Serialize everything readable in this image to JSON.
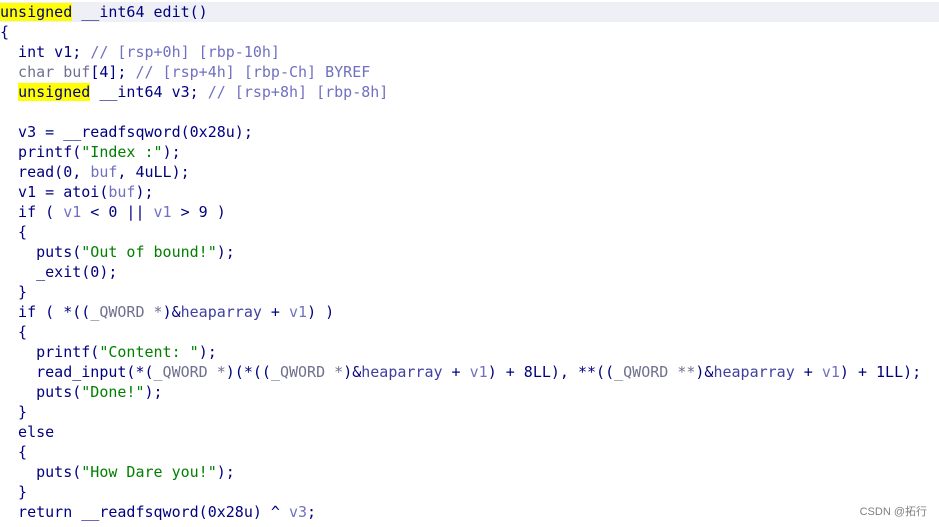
{
  "lines": [
    [
      [
        "unsigned",
        "kw",
        "hl"
      ],
      [
        " __int64 edit()",
        "kw"
      ]
    ],
    [
      [
        "{",
        "punc"
      ]
    ],
    [
      [
        "  int v1; ",
        "kw"
      ],
      [
        "// [rsp+0h] [rbp-10h]",
        "comment"
      ]
    ],
    [
      [
        "  char buf",
        "type"
      ],
      [
        "[4]",
        "kw"
      ],
      [
        "; ",
        "kw"
      ],
      [
        "// [rsp+4h] [rbp-Ch] BYREF",
        "comment"
      ]
    ],
    [
      [
        "  ",
        "kw"
      ],
      [
        "unsigned",
        "kw",
        "hl"
      ],
      [
        " __int64 v3; ",
        "kw"
      ],
      [
        "// [rsp+8h] [rbp-8h]",
        "comment"
      ]
    ],
    [
      [
        "",
        "kw"
      ]
    ],
    [
      [
        "  v3 = __readfsqword(0x28u);",
        "kw"
      ]
    ],
    [
      [
        "  printf(",
        "kw"
      ],
      [
        "\"Index :\"",
        "str"
      ],
      [
        ");",
        "kw"
      ]
    ],
    [
      [
        "  read(0, ",
        "kw"
      ],
      [
        "buf",
        "var"
      ],
      [
        ", 4uLL);",
        "kw"
      ]
    ],
    [
      [
        "  v1 = atoi(",
        "kw"
      ],
      [
        "buf",
        "var"
      ],
      [
        ");",
        "kw"
      ]
    ],
    [
      [
        "  if ( ",
        "kw"
      ],
      [
        "v1",
        "var"
      ],
      [
        " < 0 || ",
        "kw"
      ],
      [
        "v1",
        "var"
      ],
      [
        " > 9 )",
        "kw"
      ]
    ],
    [
      [
        "  {",
        "kw"
      ]
    ],
    [
      [
        "    puts(",
        "kw"
      ],
      [
        "\"Out of bound!\"",
        "str"
      ],
      [
        ");",
        "kw"
      ]
    ],
    [
      [
        "    _exit(0);",
        "kw"
      ]
    ],
    [
      [
        "  }",
        "kw"
      ]
    ],
    [
      [
        "  if ( *((",
        "kw"
      ],
      [
        "_QWORD *",
        "type"
      ],
      [
        ")&",
        "kw"
      ],
      [
        "heaparray",
        "glob"
      ],
      [
        " + ",
        "kw"
      ],
      [
        "v1",
        "var"
      ],
      [
        ") )",
        "kw"
      ]
    ],
    [
      [
        "  {",
        "kw"
      ]
    ],
    [
      [
        "    printf(",
        "kw"
      ],
      [
        "\"Content: \"",
        "str"
      ],
      [
        ");",
        "kw"
      ]
    ],
    [
      [
        "    read_input(*(",
        "kw"
      ],
      [
        "_QWORD *",
        "type"
      ],
      [
        ")(*((",
        "kw"
      ],
      [
        "_QWORD *",
        "type"
      ],
      [
        ")&",
        "kw"
      ],
      [
        "heaparray",
        "glob"
      ],
      [
        " + ",
        "kw"
      ],
      [
        "v1",
        "var"
      ],
      [
        ") + 8LL), **((",
        "kw"
      ],
      [
        "_QWORD **",
        "type"
      ],
      [
        ")&",
        "kw"
      ],
      [
        "heaparray",
        "glob"
      ],
      [
        " + ",
        "kw"
      ],
      [
        "v1",
        "var"
      ],
      [
        ") + 1LL);",
        "kw"
      ]
    ],
    [
      [
        "    puts(",
        "kw"
      ],
      [
        "\"Done!\"",
        "str"
      ],
      [
        ");",
        "kw"
      ]
    ],
    [
      [
        "  }",
        "kw"
      ]
    ],
    [
      [
        "  else",
        "kw"
      ]
    ],
    [
      [
        "  {",
        "kw"
      ]
    ],
    [
      [
        "    puts(",
        "kw"
      ],
      [
        "\"How Dare you!\"",
        "str"
      ],
      [
        ");",
        "kw"
      ]
    ],
    [
      [
        "  }",
        "kw"
      ]
    ],
    [
      [
        "  return __readfsqword(0x28u) ^ ",
        "kw"
      ],
      [
        "v3",
        "var"
      ],
      [
        ";",
        "kw"
      ]
    ]
  ],
  "watermark": "CSDN @拓行"
}
